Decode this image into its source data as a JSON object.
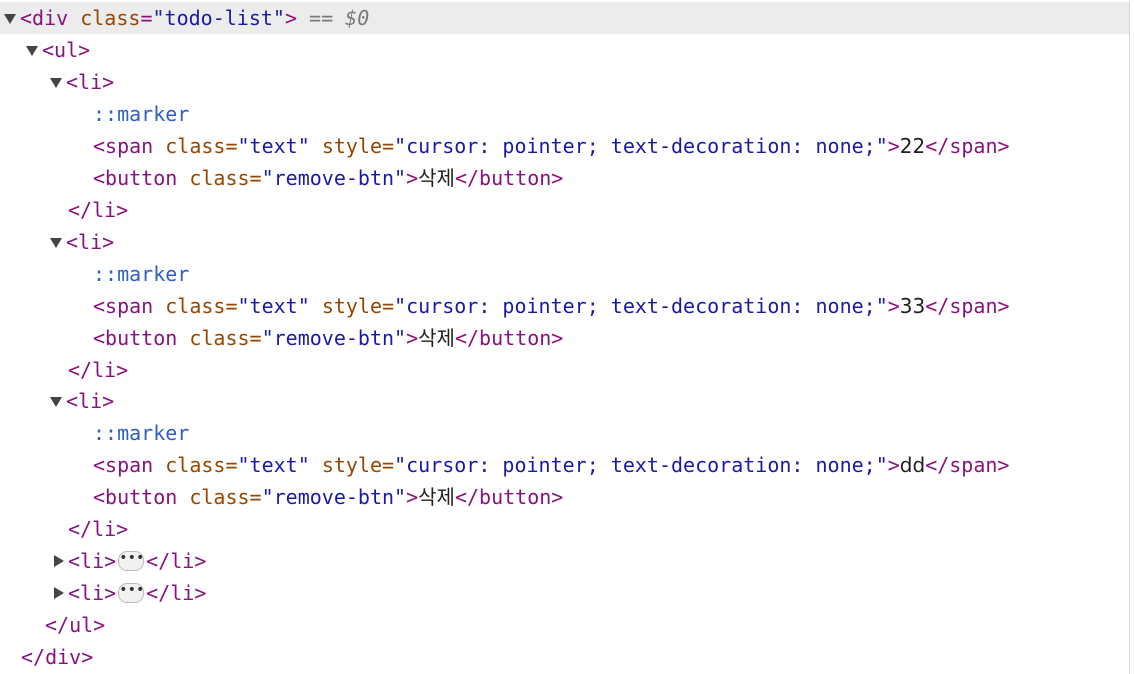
{
  "root": {
    "open_tag": "<div",
    "class_attr": "class",
    "class_value": "\"todo-list\"",
    "close_bracket": ">",
    "eq_text": "==",
    "dollar_ref": "$0",
    "end_tag": "</div>"
  },
  "ul": {
    "open_tag": "<ul>",
    "end_tag": "</ul>"
  },
  "items": [
    {
      "li_open": "<li>",
      "marker": "::marker",
      "span_open": "<span",
      "span_class_attr": "class=",
      "span_class_value": "\"text\"",
      "span_style_attr": "style=",
      "span_style_value": "\"cursor: pointer; text-decoration: none;\"",
      "span_gt": ">",
      "text": "22",
      "span_close": "</span>",
      "button_open": "<button",
      "button_class_attr": "class=",
      "button_class_value": "\"remove-btn\"",
      "button_gt": ">",
      "button_text": "삭제",
      "button_close": "</button>",
      "li_close": "</li>"
    },
    {
      "li_open": "<li>",
      "marker": "::marker",
      "span_open": "<span",
      "span_class_attr": "class=",
      "span_class_value": "\"text\"",
      "span_style_attr": "style=",
      "span_style_value": "\"cursor: pointer; text-decoration: none;\"",
      "span_gt": ">",
      "text": "33",
      "span_close": "</span>",
      "button_open": "<button",
      "button_class_attr": "class=",
      "button_class_value": "\"remove-btn\"",
      "button_gt": ">",
      "button_text": "삭제",
      "button_close": "</button>",
      "li_close": "</li>"
    },
    {
      "li_open": "<li>",
      "marker": "::marker",
      "span_open": "<span",
      "span_class_attr": "class=",
      "span_class_value": "\"text\"",
      "span_style_attr": "style=",
      "span_style_value": "\"cursor: pointer; text-decoration: none;\"",
      "span_gt": ">",
      "text": "dd",
      "span_close": "</span>",
      "button_open": "<button",
      "button_class_attr": "class=",
      "button_class_value": "\"remove-btn\"",
      "button_gt": ">",
      "button_text": "삭제",
      "button_close": "</button>",
      "li_close": "</li>"
    }
  ],
  "collapsed_items": [
    {
      "li_open": "<li>",
      "ellipsis": "•••",
      "li_close": "</li>"
    },
    {
      "li_open": "<li>",
      "ellipsis": "•••",
      "li_close": "</li>"
    }
  ],
  "icons": {
    "expanded": "triangle-down-icon",
    "collapsed": "triangle-right-icon",
    "ellipsis": "ellipsis-icon"
  },
  "colors": {
    "tag": "#881280",
    "attribute_name": "#994500",
    "attribute_value": "#1a1aa6",
    "pseudo_element": "#2f5ec4",
    "selected_row": "#ececec"
  }
}
